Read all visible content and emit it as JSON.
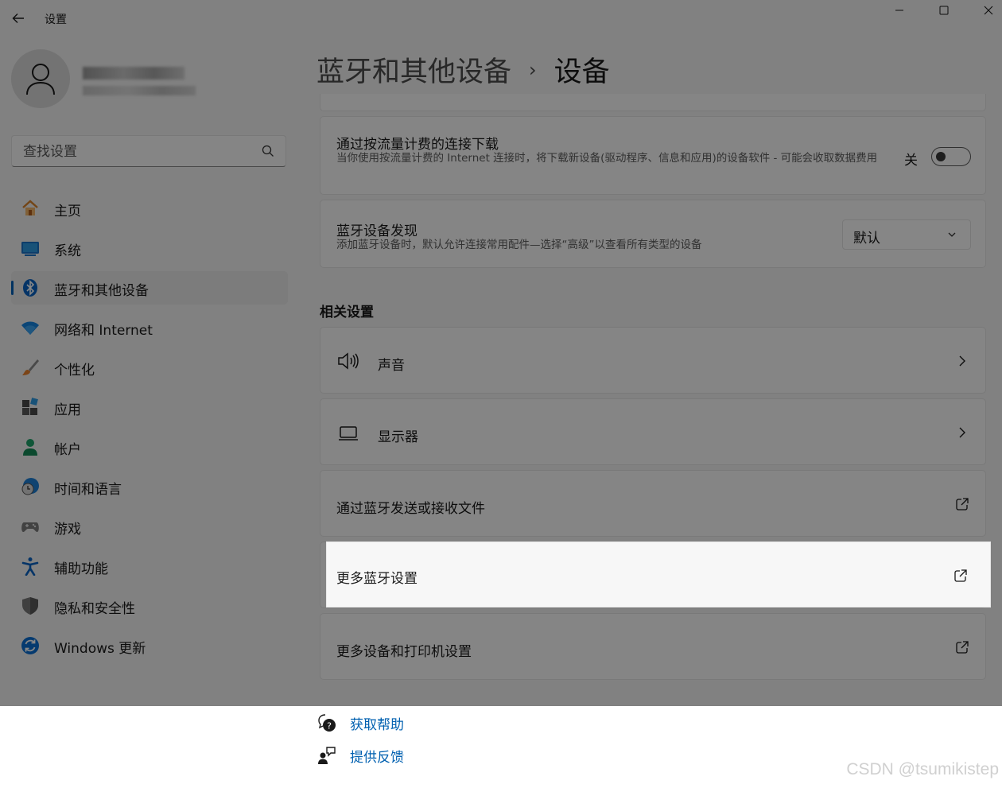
{
  "app": {
    "title": "设置"
  },
  "window_controls": {
    "minimize": "minimize-icon",
    "maximize": "maximize-icon",
    "close": "close-icon"
  },
  "search": {
    "placeholder": "查找设置"
  },
  "sidebar": {
    "items": [
      {
        "label": "主页",
        "icon": "home-icon"
      },
      {
        "label": "系统",
        "icon": "system-icon"
      },
      {
        "label": "蓝牙和其他设备",
        "icon": "bluetooth-icon",
        "active": true
      },
      {
        "label": "网络和 Internet",
        "icon": "wifi-icon"
      },
      {
        "label": "个性化",
        "icon": "brush-icon"
      },
      {
        "label": "应用",
        "icon": "apps-icon"
      },
      {
        "label": "帐户",
        "icon": "account-icon"
      },
      {
        "label": "时间和语言",
        "icon": "clock-globe-icon"
      },
      {
        "label": "游戏",
        "icon": "gamepad-icon"
      },
      {
        "label": "辅助功能",
        "icon": "accessibility-icon"
      },
      {
        "label": "隐私和安全性",
        "icon": "shield-icon"
      },
      {
        "label": "Windows 更新",
        "icon": "update-icon"
      }
    ]
  },
  "breadcrumb": {
    "parent": "蓝牙和其他设备",
    "separator": "›",
    "current": "设备"
  },
  "metered": {
    "title": "通过按流量计费的连接下载",
    "description": "当你使用按流量计费的 Internet 连接时，将下载新设备(驱动程序、信息和应用)的设备软件 - 可能会收取数据费用",
    "state_label": "关",
    "on": false
  },
  "discovery": {
    "title": "蓝牙设备发现",
    "description": "添加蓝牙设备时，默认允许连接常用配件—选择“高级”以查看所有类型的设备",
    "value": "默认"
  },
  "related": {
    "heading": "相关设置",
    "items": [
      {
        "label": "声音",
        "icon": "speaker-icon",
        "end": "chevron-right-icon"
      },
      {
        "label": "显示器",
        "icon": "laptop-icon",
        "end": "chevron-right-icon"
      },
      {
        "label": "通过蓝牙发送或接收文件",
        "end": "external-link-icon"
      },
      {
        "label": "更多蓝牙设置",
        "end": "external-link-icon",
        "highlighted": true
      },
      {
        "label": "更多设备和打印机设置",
        "end": "external-link-icon"
      }
    ]
  },
  "help": {
    "get_help": "获取帮助",
    "feedback": "提供反馈"
  },
  "watermark": "CSDN @tsumikistep",
  "colors": {
    "accent": "#005fb8",
    "link": "#0060b0",
    "dim_overlay": "rgba(0,0,0,0.47)"
  }
}
